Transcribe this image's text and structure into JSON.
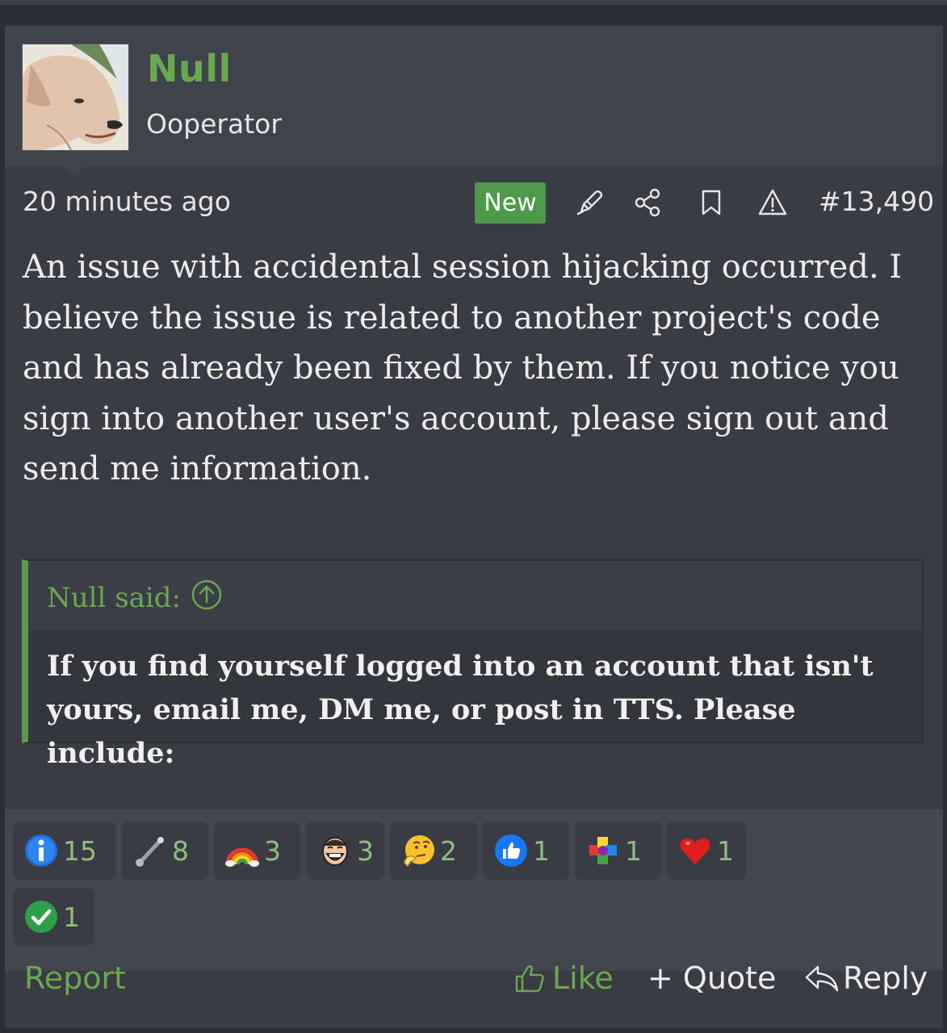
{
  "user": {
    "name": "Null",
    "title": "Ooperator",
    "avatar_icon": "dog-avatar"
  },
  "post": {
    "time": "20 minutes ago",
    "badge": "New",
    "number": "#13,490",
    "body": "An issue with accidental session hijacking occurred. I believe the issue is related to another project's code and has already been fixed by them. If you notice you sign into another user's account, please sign out and send me information."
  },
  "actions": {
    "edit_icon": "pencil-icon",
    "share_icon": "share-icon",
    "bookmark_icon": "bookmark-icon",
    "report_icon": "warning-icon"
  },
  "quote": {
    "author": "Null said:",
    "text": "If you find yourself logged into an account that isn't yours, email me, DM me, or post in TTS. Please include:"
  },
  "reactions": [
    {
      "icon": "info-icon",
      "count": "15"
    },
    {
      "icon": "pipe-icon",
      "count": "8"
    },
    {
      "icon": "rainbow-icon",
      "count": "3"
    },
    {
      "icon": "laughing-face-icon",
      "count": "3"
    },
    {
      "icon": "thinking-face-icon",
      "count": "2"
    },
    {
      "icon": "thumbs-up-icon",
      "count": "1"
    },
    {
      "icon": "puzzle-icon",
      "count": "1"
    },
    {
      "icon": "heart-icon",
      "count": "1"
    },
    {
      "icon": "checkmark-icon",
      "count": "1"
    }
  ],
  "footer": {
    "report": "Report",
    "like": "Like",
    "quote": "+ Quote",
    "reply": "Reply"
  },
  "colors": {
    "accent_green": "#6aa84f",
    "badge_green": "#4e9a4a",
    "background": "#393c44"
  }
}
